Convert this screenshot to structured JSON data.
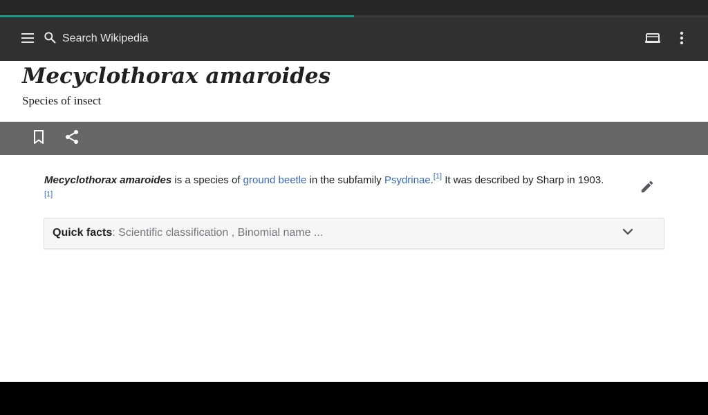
{
  "progress": {
    "fraction": 0.5,
    "color": "#1d9a8a"
  },
  "toolbar": {
    "search_placeholder": "Search Wikipedia",
    "icons": [
      "menu-icon",
      "search-icon",
      "tabs-icon",
      "more-vert-icon"
    ]
  },
  "article": {
    "title": "Mecyclothorax amaroides",
    "description": "Species of insect",
    "lead": {
      "subject": "Mecyclothorax amaroides",
      "text1": " is a species of ",
      "link1": "ground beetle",
      "text2": " in the subfamily ",
      "link2": "Psydrinae",
      "text3": ".",
      "ref1": "[1]",
      "text4": " It was described by Sharp in 1903.",
      "ref2": "[1]"
    }
  },
  "action_bar": {
    "icons": [
      "bookmark-icon",
      "share-icon"
    ]
  },
  "quick_facts": {
    "label": "Quick facts",
    "separator": ": ",
    "summary": "Scientific classification , Binomial name ..."
  },
  "colors": {
    "link": "#3366cc",
    "toolbar_bg": "#303030",
    "action_bar_bg": "#666666"
  }
}
